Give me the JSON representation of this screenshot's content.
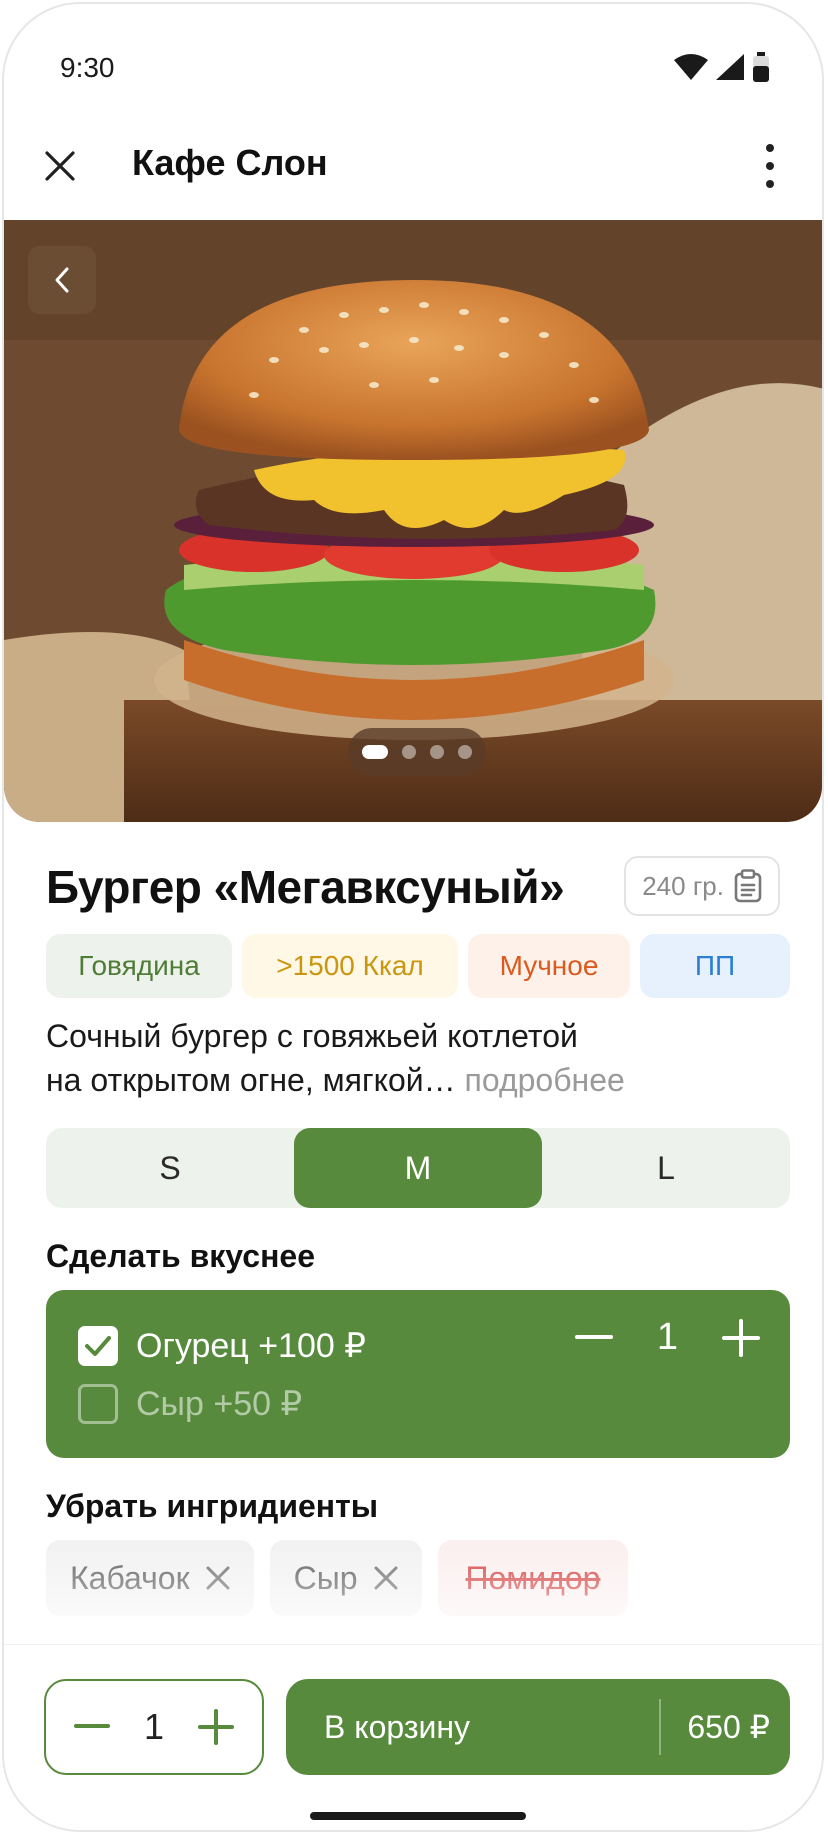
{
  "status_bar": {
    "time": "9:30"
  },
  "header": {
    "title": "Кафе Слон"
  },
  "gallery": {
    "slide_count": 4,
    "active_index": 0
  },
  "product": {
    "name": "Бургер «Мегавксуный»",
    "weight": "240 гр.",
    "tags": [
      {
        "label": "Говядина",
        "bg": "#eef2ec",
        "color": "#4f7d36"
      },
      {
        "label": ">1500 Ккал",
        "bg": "#fff8e6",
        "color": "#c9960e"
      },
      {
        "label": "Мучное",
        "bg": "#fdf1ea",
        "color": "#db5a1e"
      },
      {
        "label": "ПП",
        "bg": "#e6f1fd",
        "color": "#2a7fd4"
      }
    ],
    "description_line1": "Сочный бургер с говяжьей котлетой",
    "description_line2": "на открытом огне, мягкой…",
    "description_more": "подробнее"
  },
  "sizes": {
    "options": [
      "S",
      "M",
      "L"
    ],
    "selected": "M"
  },
  "addons": {
    "title": "Сделать вкуснее",
    "items": [
      {
        "label": "Огурец +100 ₽",
        "checked": true,
        "qty": "1"
      },
      {
        "label": "Сыр +50 ₽",
        "checked": false
      }
    ]
  },
  "remove": {
    "title": "Убрать ингридиенты",
    "items": [
      {
        "label": "Кабачок",
        "removed": false
      },
      {
        "label": "Сыр",
        "removed": false
      },
      {
        "label": "Помидор",
        "removed": true
      }
    ]
  },
  "cart": {
    "quantity": "1",
    "button_label": "В корзину",
    "price": "650 ₽"
  },
  "colors": {
    "accent": "#578a3c",
    "accent_bg": "#eef2ec"
  }
}
